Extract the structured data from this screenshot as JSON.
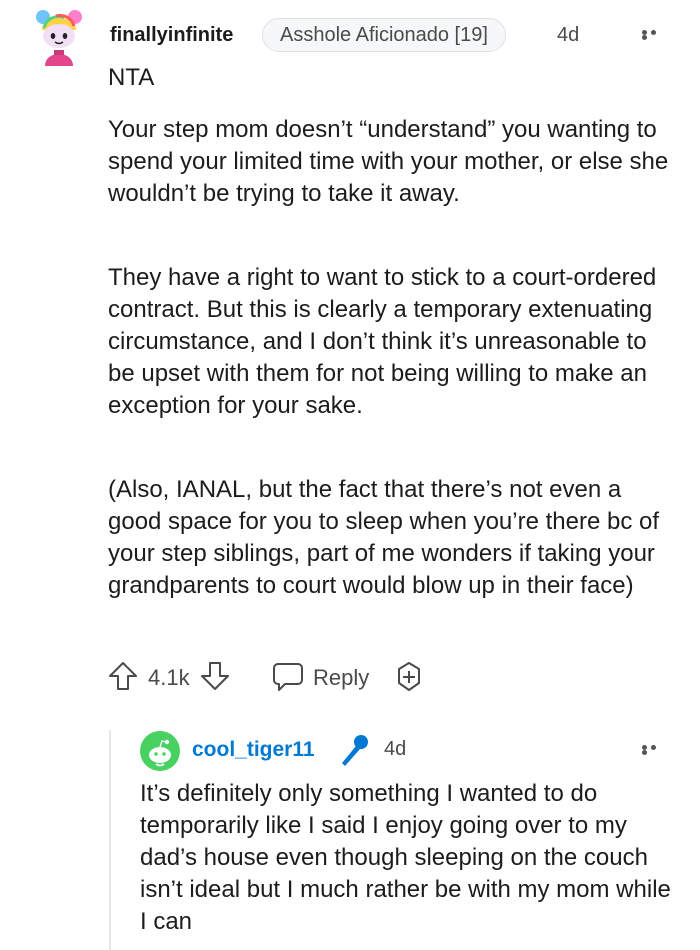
{
  "comment": {
    "username": "finallyinfinite",
    "flair": "Asshole Aficionado [19]",
    "age": "4d",
    "verdict": "NTA",
    "paragraphs": [
      "Your step mom doesn’t “understand” you wanting to spend your limited time with your mother, or else she wouldn’t be trying to take it away.",
      "They have a right to want to stick to a court-ordered contract. But this is clearly a temporary extenuating circumstance, and I don’t think it’s unreasonable to be upset with them for not being willing to make an exception for your sake.",
      "(Also, IANAL, but the fact that there’s not even a good space for you to sleep when you’re there bc of your step siblings, part of me wonders if taking your grandparents to court would blow up in their face)"
    ],
    "actions": {
      "vote_count": "4.1k",
      "reply_label": "Reply"
    }
  },
  "reply": {
    "username": "cool_tiger11",
    "age": "4d",
    "body": "It’s definitely only something I wanted to do temporarily like I said I enjoy going over to my dad’s house even though sleeping on the couch isn’t ideal but I much rather be with my mom while I can"
  },
  "colors": {
    "reply_username": "#0079d3",
    "op_badge": "#0079d3",
    "snoo_avatar_bg": "#46d160",
    "text_primary": "#1c1c1c",
    "text_secondary": "#4a4a4a"
  }
}
